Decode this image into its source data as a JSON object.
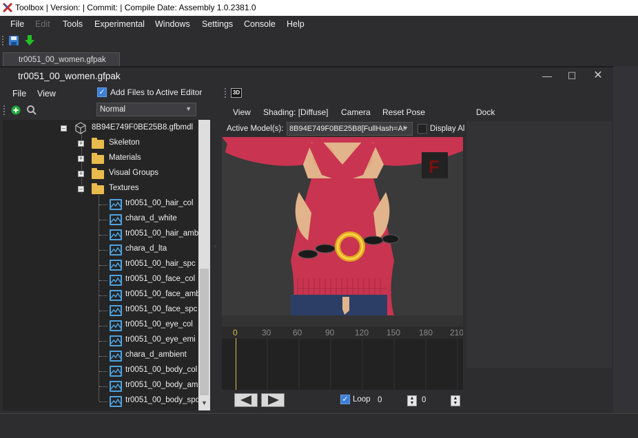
{
  "window": {
    "title": "Toolbox | Version:  | Commit:  | Compile Date:  Assembly 1.0.2381.0"
  },
  "menubar": {
    "items": [
      {
        "label": "File",
        "enabled": true
      },
      {
        "label": "Edit",
        "enabled": false
      },
      {
        "label": "Tools",
        "enabled": true
      },
      {
        "label": "Experimental",
        "enabled": true
      },
      {
        "label": "Windows",
        "enabled": true
      },
      {
        "label": "Settings",
        "enabled": true
      },
      {
        "label": "Console",
        "enabled": true
      },
      {
        "label": "Help",
        "enabled": true
      }
    ]
  },
  "toolbar": {
    "icons": [
      "save-icon",
      "download-arrow-icon"
    ]
  },
  "document_tab": {
    "label": "tr0051_00_women.gfpak"
  },
  "editor": {
    "title": "tr0051_00_women.gfpak",
    "window_buttons": [
      "minimize",
      "maximize",
      "close"
    ]
  },
  "left_panel": {
    "menu": [
      "File",
      "View"
    ],
    "add_files_checkbox": {
      "label": "Add Files to Active Editor",
      "checked": true
    },
    "mode_select": {
      "value": "Normal"
    },
    "tree": {
      "root": "8B94E749F0BE25B8.gfbmdl",
      "groups": [
        {
          "label": "Skeleton",
          "expanded": false
        },
        {
          "label": "Materials",
          "expanded": false
        },
        {
          "label": "Visual Groups",
          "expanded": false
        },
        {
          "label": "Textures",
          "expanded": true
        }
      ],
      "textures": [
        "tr0051_00_hair_col",
        "chara_d_white",
        "tr0051_00_hair_amb",
        "chara_d_lta",
        "tr0051_00_hair_spc",
        "tr0051_00_face_col",
        "tr0051_00_face_amb",
        "tr0051_00_face_spc",
        "tr0051_00_eye_col",
        "tr0051_00_eye_emi",
        "chara_d_ambient",
        "tr0051_00_body_col",
        "tr0051_00_body_amb",
        "tr0051_00_body_spc"
      ]
    }
  },
  "viewport_panel": {
    "tab_icon_label": "3D",
    "menu": [
      "View",
      "Shading: [Diffuse]",
      "Camera",
      "Reset Pose"
    ],
    "active_model_label": "Active Model(s):",
    "active_model_value": "8B94E749F0BE25B8[FullHash=A!",
    "display_all_label": "Display Al",
    "display_all_checked": false
  },
  "timeline": {
    "ticks": [
      "0",
      "30",
      "60",
      "90",
      "120",
      "150",
      "180",
      "210"
    ],
    "current_frame": 0,
    "loop_label": "Loop",
    "loop_checked": true,
    "frame_value": "0",
    "end_value": "0"
  },
  "dock": {
    "label": "Dock"
  },
  "colors": {
    "background": "#2d2d30",
    "accent": "#3c7fd9",
    "texture_icon": "#4fa3e0",
    "folder": "#e8bb4c",
    "timeline_cursor": "#d8c24a"
  }
}
